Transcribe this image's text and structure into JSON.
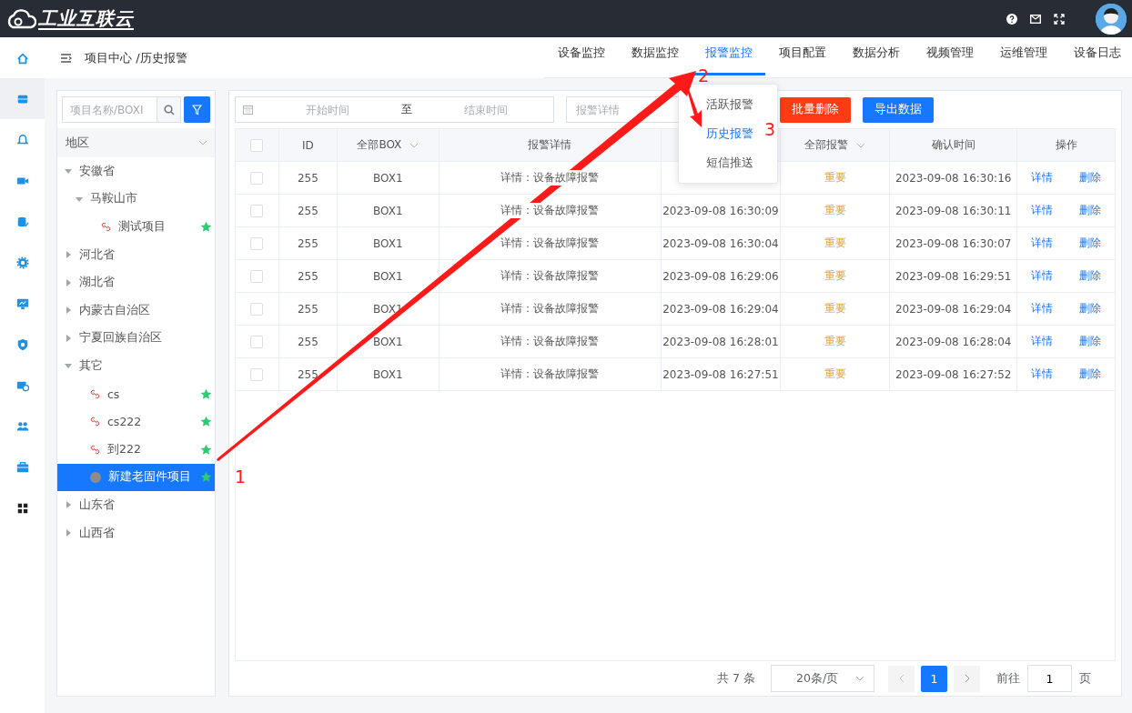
{
  "app": {
    "logo": "工业互联云"
  },
  "sidebar": {
    "items": [
      {
        "selected": false
      },
      {
        "selected": true
      },
      {
        "selected": false
      },
      {
        "selected": false
      },
      {
        "selected": false
      },
      {
        "selected": false
      },
      {
        "selected": false
      },
      {
        "selected": false
      },
      {
        "selected": false
      },
      {
        "selected": false
      },
      {
        "selected": false
      },
      {
        "selected": false
      }
    ]
  },
  "breadcrumb": "项目中心 /历史报警",
  "tabs": [
    {
      "label": "设备监控",
      "selected": false
    },
    {
      "label": "数据监控",
      "selected": false
    },
    {
      "label": "报警监控",
      "selected": true
    },
    {
      "label": "项目配置",
      "selected": false
    },
    {
      "label": "数据分析",
      "selected": false
    },
    {
      "label": "视频管理",
      "selected": false
    },
    {
      "label": "运维管理",
      "selected": false
    },
    {
      "label": "设备日志",
      "selected": false
    }
  ],
  "tab_menu": {
    "items": [
      {
        "label": "活跃报警",
        "selected": false
      },
      {
        "label": "历史报警",
        "selected": true
      },
      {
        "label": "短信推送",
        "selected": false
      }
    ]
  },
  "tree_panel": {
    "search": {
      "placeholder": "项目名称/BOXI"
    },
    "region_select": {
      "value": "地区"
    },
    "tree": [
      {
        "kind": "region",
        "label": "安徽省",
        "expanded": true,
        "selected": false,
        "children": [
          {
            "kind": "region",
            "label": "马鞍山市",
            "expanded": true,
            "selected": false,
            "children": [
              {
                "kind": "project",
                "label": "测试项目",
                "linked": true,
                "favorite": true,
                "selected": false
              }
            ]
          }
        ]
      },
      {
        "kind": "region",
        "label": "河北省",
        "expanded": false,
        "selected": false
      },
      {
        "kind": "region",
        "label": "湖北省",
        "expanded": false,
        "selected": false
      },
      {
        "kind": "region",
        "label": "内蒙古自治区",
        "expanded": false,
        "selected": false
      },
      {
        "kind": "region",
        "label": "宁夏回族自治区",
        "expanded": false,
        "selected": false
      },
      {
        "kind": "region",
        "label": "其它",
        "expanded": true,
        "selected": false,
        "children": [
          {
            "kind": "project",
            "label": "cs",
            "linked": true,
            "favorite": true,
            "selected": false
          },
          {
            "kind": "project",
            "label": "cs222",
            "linked": true,
            "favorite": true,
            "selected": false
          },
          {
            "kind": "project",
            "label": "到222",
            "linked": true,
            "favorite": true,
            "selected": false
          },
          {
            "kind": "project",
            "label": "新建老固件项目",
            "linked": false,
            "favorite": true,
            "selected": true
          }
        ]
      },
      {
        "kind": "region",
        "label": "山东省",
        "expanded": false,
        "selected": false
      },
      {
        "kind": "region",
        "label": "山西省",
        "expanded": false,
        "selected": false
      }
    ]
  },
  "filters": {
    "start_placeholder": "开始时间",
    "separator": "至",
    "end_placeholder": "结束时间",
    "detail_placeholder": "报警详情"
  },
  "buttons": [
    {
      "label": "批量删除",
      "kind": "danger"
    },
    {
      "label": "导出数据",
      "kind": "primary"
    }
  ],
  "table": {
    "columns": [
      {
        "kind": "checkbox",
        "checked": false
      },
      {
        "kind": "plain",
        "label": "ID"
      },
      {
        "kind": "filter",
        "label": "全部BOX"
      },
      {
        "kind": "plain",
        "label": "报警详情"
      },
      {
        "kind": "plain"
      },
      {
        "kind": "filter",
        "label": "全部报警"
      },
      {
        "kind": "plain",
        "label": "确认时间"
      },
      {
        "kind": "plain",
        "label": "操作"
      }
    ],
    "rows": [
      {
        "checked": false,
        "id": "255",
        "box": "BOX1",
        "detail": "详情：设备故障报警",
        "level": "重要",
        "confirm_time": "2023-09-08 16:30:16",
        "actions": [
          "详情",
          "删除"
        ]
      },
      {
        "checked": false,
        "id": "255",
        "box": "BOX1",
        "detail": "详情：设备故障报警",
        "alarm_time": "2023-09-08 16:30:09",
        "level": "重要",
        "confirm_time": "2023-09-08 16:30:11",
        "actions": [
          "详情",
          "删除"
        ]
      },
      {
        "checked": false,
        "id": "255",
        "box": "BOX1",
        "detail": "详情：设备故障报警",
        "alarm_time": "2023-09-08 16:30:04",
        "level": "重要",
        "confirm_time": "2023-09-08 16:30:07",
        "actions": [
          "详情",
          "删除"
        ]
      },
      {
        "checked": false,
        "id": "255",
        "box": "BOX1",
        "detail": "详情：设备故障报警",
        "alarm_time": "2023-09-08 16:29:06",
        "level": "重要",
        "confirm_time": "2023-09-08 16:29:51",
        "actions": [
          "详情",
          "删除"
        ]
      },
      {
        "checked": false,
        "id": "255",
        "box": "BOX1",
        "detail": "详情：设备故障报警",
        "alarm_time": "2023-09-08 16:29:04",
        "level": "重要",
        "confirm_time": "2023-09-08 16:29:04",
        "actions": [
          "详情",
          "删除"
        ]
      },
      {
        "checked": false,
        "id": "255",
        "box": "BOX1",
        "detail": "详情：设备故障报警",
        "alarm_time": "2023-09-08 16:28:01",
        "level": "重要",
        "confirm_time": "2023-09-08 16:28:04",
        "actions": [
          "详情",
          "删除"
        ]
      },
      {
        "checked": false,
        "id": "255",
        "box": "BOX1",
        "detail": "详情：设备故障报警",
        "alarm_time": "2023-09-08 16:27:51",
        "level": "重要",
        "confirm_time": "2023-09-08 16:27:52",
        "actions": [
          "详情",
          "删除"
        ]
      }
    ]
  },
  "pager": {
    "total": "共 7 条",
    "page_size": "20条/页",
    "pages": [
      {
        "label": "1",
        "selected": true
      }
    ],
    "goto_label": "前往",
    "goto_value": "1",
    "page_suffix": "页"
  },
  "annotations": [
    {
      "label": "1"
    },
    {
      "label": "2"
    },
    {
      "label": "3"
    }
  ]
}
